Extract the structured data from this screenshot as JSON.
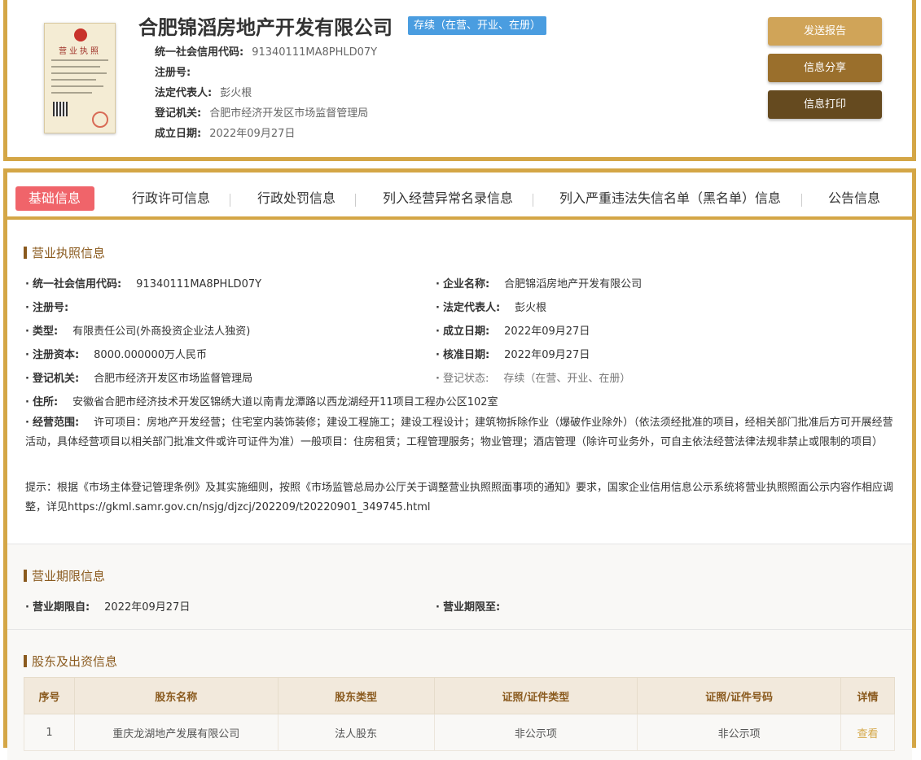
{
  "header": {
    "license_title": "营业执照",
    "company_name": "合肥锦滔房地产开发有限公司",
    "status": "存续（在营、开业、在册）",
    "rows": [
      {
        "label": "统一社会信用代码:",
        "value": "91340111MA8PHLD07Y"
      },
      {
        "label": "注册号:",
        "value": ""
      },
      {
        "label": "法定代表人:",
        "value": "彭火根"
      },
      {
        "label": "登记机关:",
        "value": "合肥市经济开发区市场监督管理局"
      },
      {
        "label": "成立日期:",
        "value": "2022年09月27日"
      }
    ],
    "buttons": {
      "send": "发送报告",
      "share": "信息分享",
      "print": "信息打印"
    }
  },
  "tabs": [
    "基础信息",
    "行政许可信息",
    "行政处罚信息",
    "列入经营异常名录信息",
    "列入严重违法失信名单（黑名单）信息",
    "公告信息"
  ],
  "license_section": {
    "title": "营业执照信息",
    "fields": {
      "credit_code": {
        "label": "统一社会信用代码:",
        "value": "91340111MA8PHLD07Y"
      },
      "company_name": {
        "label": "企业名称:",
        "value": "合肥锦滔房地产开发有限公司"
      },
      "reg_no": {
        "label": "注册号:",
        "value": ""
      },
      "legal_rep": {
        "label": "法定代表人:",
        "value": "彭火根"
      },
      "type": {
        "label": "类型:",
        "value": "有限责任公司(外商投资企业法人独资)"
      },
      "found_date": {
        "label": "成立日期:",
        "value": "2022年09月27日"
      },
      "capital": {
        "label": "注册资本:",
        "value": "8000.000000万人民币"
      },
      "approve_date": {
        "label": "核准日期:",
        "value": "2022年09月27日"
      },
      "reg_authority": {
        "label": "登记机关:",
        "value": "合肥市经济开发区市场监督管理局"
      },
      "reg_status": {
        "label": "登记状态:",
        "value": "存续（在营、开业、在册）"
      },
      "address": {
        "label": "住所:",
        "value": "安徽省合肥市经济技术开发区锦绣大道以南青龙潭路以西龙湖经开11项目工程办公区102室"
      }
    },
    "scope_label": "经营范围:",
    "scope_text": "许可项目：房地产开发经营；住宅室内装饰装修；建设工程施工；建设工程设计；建筑物拆除作业（爆破作业除外）（依法须经批准的项目，经相关部门批准后方可开展经营活动，具体经营项目以相关部门批准文件或许可证件为准）一般项目：住房租赁；工程管理服务；物业管理；酒店管理（除许可业务外，可自主依法经营法律法规非禁止或限制的项目）",
    "notice": "提示：根据《市场主体登记管理条例》及其实施细则，按照《市场监管总局办公厅关于调整营业执照照面事项的通知》要求，国家企业信用信息公示系统将营业执照照面公示内容作相应调整，详见https://gkml.samr.gov.cn/nsjg/djzcj/202209/t20220901_349745.html"
  },
  "term_section": {
    "title": "营业期限信息",
    "from": {
      "label": "营业期限自:",
      "value": "2022年09月27日"
    },
    "to": {
      "label": "营业期限至:",
      "value": ""
    }
  },
  "shareholder_section": {
    "title": "股东及出资信息",
    "columns": [
      "序号",
      "股东名称",
      "股东类型",
      "证照/证件类型",
      "证照/证件号码",
      "详情"
    ],
    "rows": [
      {
        "no": "1",
        "name": "重庆龙湖地产发展有限公司",
        "type": "法人股东",
        "cert_type": "非公示项",
        "cert_no": "非公示项",
        "detail": "查看"
      }
    ]
  }
}
